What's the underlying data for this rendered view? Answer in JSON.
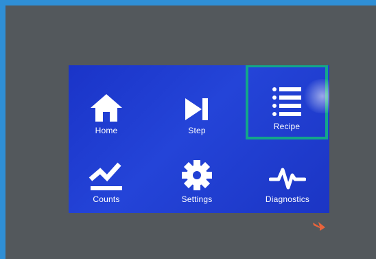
{
  "menu": {
    "home_label": "Home",
    "step_label": "Step",
    "recipe_label": "Recipe",
    "counts_label": "Counts",
    "settings_label": "Settings",
    "diagnostics_label": "Diagnostics",
    "selected_item": "Recipe"
  },
  "colors": {
    "bezel": "#53585c",
    "frame_accent": "#2f8fd6",
    "screen_blue": "#1f3ccf",
    "selection_border": "#13a68a",
    "icon_white": "#ffffff",
    "indicator_orange": "#e8643c"
  },
  "icons": {
    "home": "house-icon",
    "step": "skip-forward-icon",
    "recipe": "list-icon",
    "counts": "trend-line-icon",
    "settings": "gear-icon",
    "diagnostics": "heartbeat-icon",
    "indicator": "hand-pointer-icon"
  }
}
